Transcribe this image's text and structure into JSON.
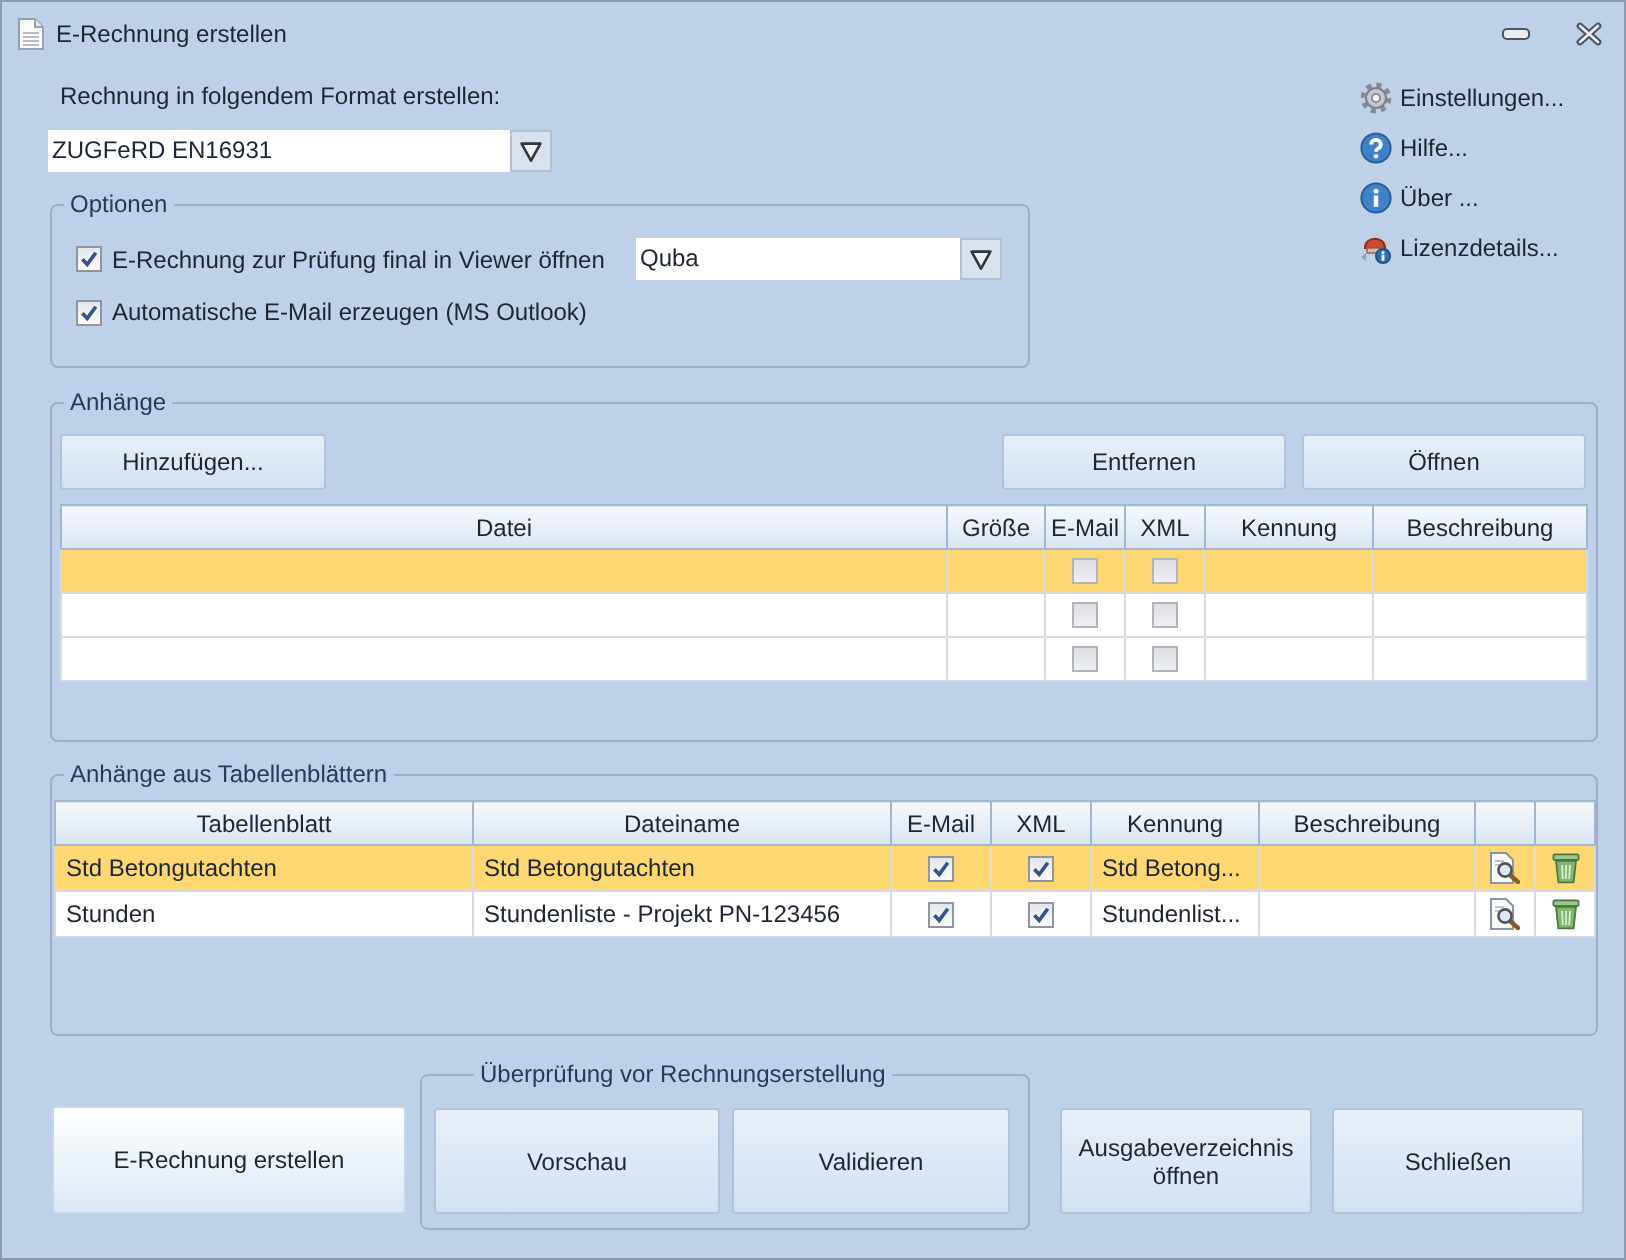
{
  "window": {
    "title": "E-Rechnung erstellen"
  },
  "format": {
    "label": "Rechnung in folgendem Format erstellen:",
    "value": "ZUGFeRD EN16931"
  },
  "links": [
    {
      "kind": "settings",
      "label": "Einstellungen..."
    },
    {
      "kind": "help",
      "label": "Hilfe..."
    },
    {
      "kind": "about",
      "label": "Über ..."
    },
    {
      "kind": "license",
      "label": "Lizenzdetails..."
    }
  ],
  "options": {
    "title": "Optionen",
    "items": [
      {
        "label": "E-Rechnung zur Prüfung final in Viewer öffnen",
        "checked": true,
        "viewer": "Quba"
      },
      {
        "label": "Automatische E-Mail erzeugen (MS Outlook)",
        "checked": true
      }
    ]
  },
  "attachments": {
    "title": "Anhänge",
    "buttons": [
      "Hinzufügen...",
      "Entfernen",
      "Öffnen"
    ],
    "table": {
      "columns": [
        "Datei",
        "Größe",
        "E-Mail",
        "XML",
        "Kennung",
        "Beschreibung"
      ],
      "rows": [
        {
          "selected": true,
          "email": false,
          "xml": false
        },
        {
          "selected": false,
          "email": false,
          "xml": false
        },
        {
          "selected": false,
          "email": false,
          "xml": false
        }
      ]
    }
  },
  "sheet_attachments": {
    "title": "Anhänge aus Tabellenblättern",
    "table": {
      "columns": [
        "Tabellenblatt",
        "Dateiname",
        "E-Mail",
        "XML",
        "Kennung",
        "Beschreibung"
      ],
      "rows": [
        {
          "selected": true,
          "sheet": "Std Betongutachten",
          "file": "Std Betongutachten",
          "email": true,
          "xml": true,
          "id": "Std Betong..."
        },
        {
          "selected": false,
          "sheet": "Stunden",
          "file": "Stundenliste - Projekt PN-123456",
          "email": true,
          "xml": true,
          "id": "Stundenlist..."
        }
      ]
    }
  },
  "bottom": {
    "create_button": "E-Rechnung erstellen",
    "review": {
      "title": "Überprüfung vor Rechnungserstellung",
      "buttons": [
        "Vorschau",
        "Validieren"
      ]
    },
    "buttons": [
      "Ausgabeverzeichnis öffnen",
      "Schließen"
    ]
  }
}
